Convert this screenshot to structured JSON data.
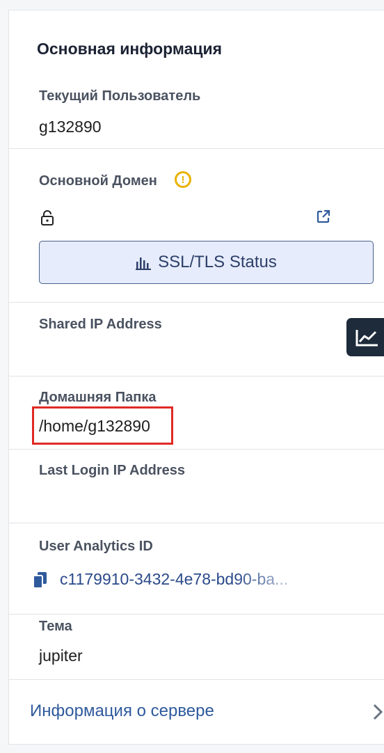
{
  "panel": {
    "title": "Основная информация"
  },
  "current_user": {
    "label": "Текущий Пользователь",
    "value": "g132890"
  },
  "main_domain": {
    "label": "Основной Домен",
    "warning_icon": "exclamation-circle-icon",
    "lock_icon": "unlock-icon",
    "external_icon": "external-link-icon",
    "ssl_button_label": "SSL/TLS Status",
    "ssl_button_icon": "bar-chart-icon"
  },
  "shared_ip": {
    "label": "Shared IP Address"
  },
  "home_dir": {
    "label": "Домашняя Папка",
    "value": "/home/g132890"
  },
  "last_login_ip": {
    "label": "Last Login IP Address"
  },
  "user_analytics": {
    "label": "User Analytics ID",
    "value": "c1179910-3432-4e78-bd90-ba...",
    "copy_icon": "copy-icon"
  },
  "theme": {
    "label": "Тема",
    "value": "jupiter"
  },
  "server_info": {
    "link_label": "Информация о сервере",
    "chevron_icon": "chevron-right-icon"
  },
  "float_button_icon": "line-chart-icon",
  "colors": {
    "accent": "#2f5a9c",
    "warning": "#e9b200",
    "highlight": "#e02a25",
    "button_bg": "#e6ecfb",
    "float_bg": "#1d2b3b"
  }
}
